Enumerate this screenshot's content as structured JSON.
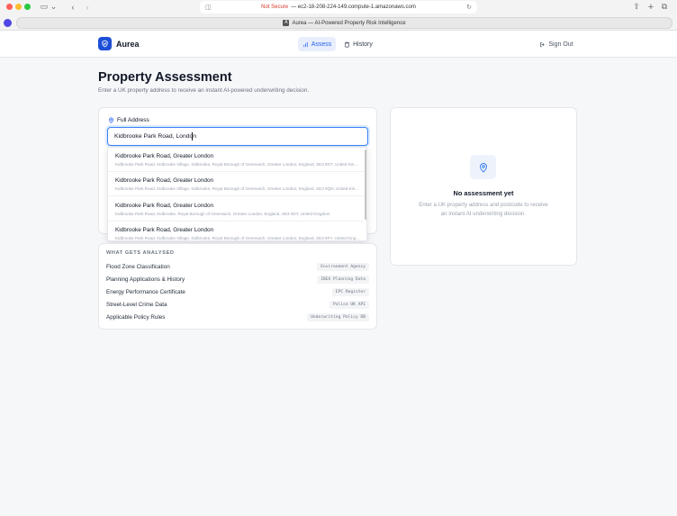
{
  "browser": {
    "url_prefix": "Not Secure",
    "url": "— ec2-18-208-224-149.compute-1.amazonaws.com",
    "tab_title": "Aurea — AI-Powered Property Risk Intelligence"
  },
  "header": {
    "brand": "Aurea",
    "nav_assess": "Assess",
    "nav_history": "History",
    "sign_out": "Sign Out"
  },
  "page": {
    "title": "Property Assessment",
    "subtitle": "Enter a UK property address to receive an instant AI-powered underwriting decision."
  },
  "form": {
    "address_label": "Full Address",
    "address_value": "Kidbrooke Park Road, London"
  },
  "suggestions": [
    {
      "main": "Kidbrooke Park Road, Greater London",
      "detail": "Kidbrooke Park Road, Kidbrooke Village, Kidbrooke, Royal Borough of Greenwich, Greater London, England, SE3 8GT, United Kingdom"
    },
    {
      "main": "Kidbrooke Park Road, Greater London",
      "detail": "Kidbrooke Park Road, Kidbrooke Village, Kidbrooke, Royal Borough of Greenwich, Greater London, England, SE3 9QN, United Kingdom"
    },
    {
      "main": "Kidbrooke Park Road, Greater London",
      "detail": "Kidbrooke Park Road, Kidbrooke, Royal Borough of Greenwich, Greater London, England, SE3 0DY, United Kingdom"
    },
    {
      "main": "Kidbrooke Park Road, Greater London",
      "detail": "Kidbrooke Park Road, Kidbrooke Village, Kidbrooke, Royal Borough of Greenwich, Greater London, England, SE3 9FY, United Kingdom"
    }
  ],
  "analysed": {
    "title": "WHAT GETS ANALYSED",
    "items": [
      {
        "name": "Flood Zone Classification",
        "source": "Environment Agency"
      },
      {
        "name": "Planning Applications & History",
        "source": "IBEX Planning Data"
      },
      {
        "name": "Energy Performance Certificate",
        "source": "EPC Register"
      },
      {
        "name": "Street-Level Crime Data",
        "source": "Police UK API"
      },
      {
        "name": "Applicable Policy Rules",
        "source": "Underwriting Policy DB"
      }
    ]
  },
  "empty_state": {
    "title": "No assessment yet",
    "description": "Enter a UK property address and postcode to receive an instant AI underwriting decision."
  }
}
